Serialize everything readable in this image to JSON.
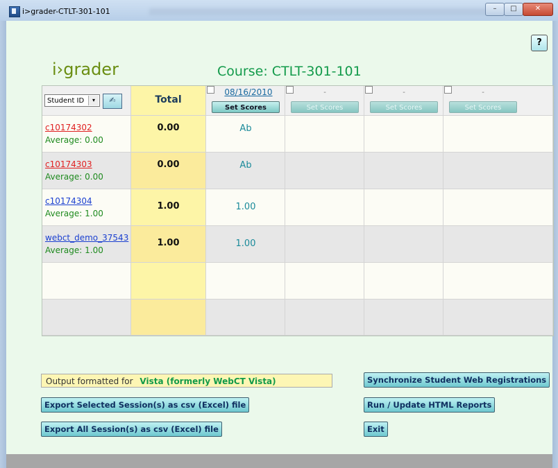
{
  "window": {
    "title": "i>grader-CTLT-301-101",
    "buttons": {
      "minimize": "–",
      "maximize": "□",
      "close": "✕"
    }
  },
  "app": {
    "help_label": "?",
    "logo": "i›grader",
    "course_prefix": "Course:",
    "course_id": "CTLT-301-101"
  },
  "grid": {
    "sort_select": "Student ID",
    "sort_arrow": "▾",
    "signature_icon": "signature-icon",
    "total_header": "Total",
    "sessions": [
      {
        "date": "08/16/2010",
        "button": "Set Scores",
        "active": true
      },
      {
        "date": "-",
        "button": "Set Scores",
        "active": false
      },
      {
        "date": "-",
        "button": "Set Scores",
        "active": false
      },
      {
        "date": "-",
        "button": "Set Scores",
        "active": false
      }
    ],
    "rows": [
      {
        "id": "c10174302",
        "average": "Average: 0.00",
        "total": "0.00",
        "score": "Ab",
        "link_color": "#e02020"
      },
      {
        "id": "c10174303",
        "average": "Average: 0.00",
        "total": "0.00",
        "score": "Ab",
        "link_color": "#e02020"
      },
      {
        "id": "c10174304",
        "average": "Average: 1.00",
        "total": "1.00",
        "score": "1.00",
        "link_color": "#1a3fd0"
      },
      {
        "id": "webct_demo_37543",
        "average": "Average: 1.00",
        "total": "1.00",
        "score": "1.00",
        "link_color": "#1a3fd0"
      }
    ]
  },
  "output": {
    "label": "Output formatted for",
    "value": "Vista (formerly WebCT Vista)"
  },
  "buttons": {
    "export_selected": "Export Selected Session(s) as csv (Excel) file",
    "export_all": "Export All Session(s) as csv (Excel) file",
    "sync": "Synchronize Student Web Registrations",
    "run_reports": "Run / Update HTML Reports",
    "exit": "Exit"
  }
}
